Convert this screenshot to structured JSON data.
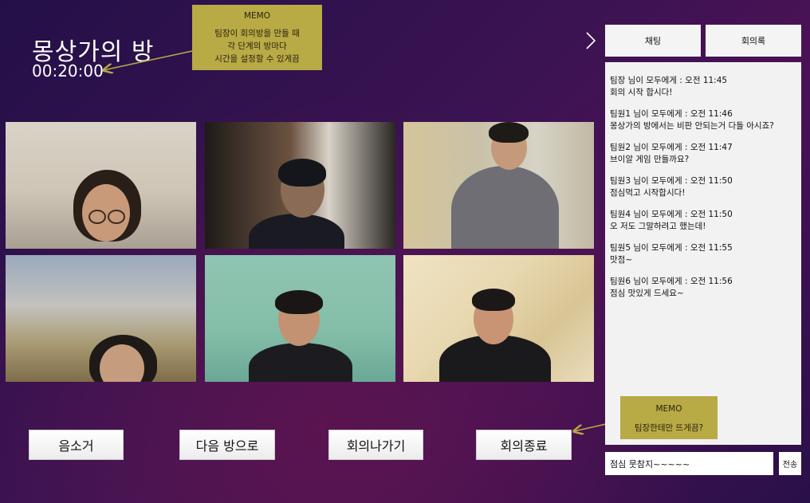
{
  "room": {
    "title": "몽상가의 방",
    "timer": "00:20:00"
  },
  "memo_top": {
    "title": "MEMO",
    "lines": [
      "팀장이 회의방을 만들 때",
      "각 단계의 방마다",
      "시간을 설정할 수 있게끔"
    ]
  },
  "memo_bottom": {
    "title": "MEMO",
    "lines": [
      "팀장한테만 뜨게끔?"
    ]
  },
  "controls": {
    "mute": "음소거",
    "next_room": "다음 방으로",
    "leave": "회의나가기",
    "end": "회의종료"
  },
  "tabs": {
    "chat": "채팅",
    "minutes": "회의록"
  },
  "chat": {
    "messages": [
      {
        "header": "팀장 님이 모두에게 : 오전 11:45",
        "text": "회의 시작 합시다!"
      },
      {
        "header": "팀원1 님이 모두에게 : 오전 11:46",
        "text": "몽상가의 방에서는 비판 안되는거 다들 아시죠?"
      },
      {
        "header": "팀원2 님이 모두에게 : 오전 11:47",
        "text": "브이알 게임 만들까요?"
      },
      {
        "header": "팀원3 님이 모두에게 : 오전 11:50",
        "text": "점심먹고 시작합시다!"
      },
      {
        "header": "팀원4 님이 모두에게 : 오전 11:50",
        "text": "오 저도 그말하려고 했는데!"
      },
      {
        "header": "팀원5 님이 모두에게 : 오전 11:55",
        "text": "맛점~"
      },
      {
        "header": "팀원6 님이 모두에게 : 오전 11:56",
        "text": "점심 맛있게 드세요~"
      }
    ],
    "input_value": "점심 뭇참지~~~~~",
    "send_label": "전송"
  },
  "icons": {
    "collapse": "chevron-right-icon"
  },
  "colors": {
    "memo": "#b8aa45",
    "arrow": "#b8aa45",
    "panel": "#f2f2f2"
  }
}
